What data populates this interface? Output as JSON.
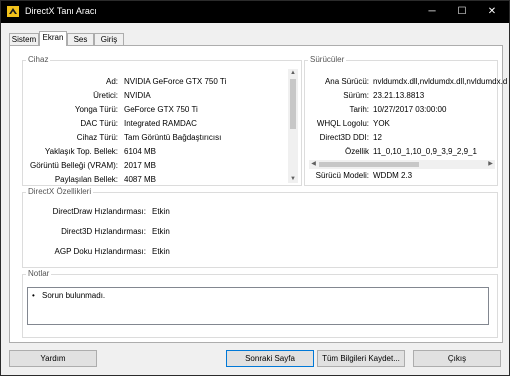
{
  "window": {
    "title": "DirectX Tanı Aracı",
    "controls": {
      "minimize": "─",
      "maximize": "☐",
      "close": "✕"
    }
  },
  "tabs": [
    {
      "label": "Sistem",
      "active": false
    },
    {
      "label": "Ekran",
      "active": true
    },
    {
      "label": "Ses",
      "active": false
    },
    {
      "label": "Giriş",
      "active": false
    }
  ],
  "device": {
    "title": "Cihaz",
    "rows": [
      {
        "label": "Ad:",
        "value": "NVIDIA GeForce GTX 750 Ti"
      },
      {
        "label": "Üretici:",
        "value": "NVIDIA"
      },
      {
        "label": "Yonga Türü:",
        "value": "GeForce GTX 750 Ti"
      },
      {
        "label": "DAC Türü:",
        "value": "Integrated RAMDAC"
      },
      {
        "label": "Cihaz Türü:",
        "value": "Tam Görüntü Bağdaştırıcısı"
      },
      {
        "label": "Yaklaşık Top. Bellek:",
        "value": "6104 MB"
      },
      {
        "label": "Görüntü Belleği (VRAM):",
        "value": "2017 MB"
      },
      {
        "label": "Paylaşılan Bellek:",
        "value": "4087 MB"
      }
    ]
  },
  "drivers": {
    "title": "Sürücüler",
    "rows": [
      {
        "label": "Ana Sürücü:",
        "value": "nvldumdx.dll,nvldumdx.dll,nvldumdx.d"
      },
      {
        "label": "Sürüm:",
        "value": "23.21.13.8813"
      },
      {
        "label": "Tarih:",
        "value": "10/27/2017 03:00:00"
      },
      {
        "label": "WHQL Logolu:",
        "value": "YOK"
      },
      {
        "label": "Direct3D DDI:",
        "value": "12"
      },
      {
        "label": "Özellik",
        "value": "11_0,10_1,10_0,9_3,9_2,9_1"
      },
      {
        "label": "Sürücü Modeli:",
        "value": "WDDM 2.3"
      }
    ]
  },
  "features": {
    "title": "DirectX Özellikleri",
    "rows": [
      {
        "label": "DirectDraw Hızlandırması:",
        "value": "Etkin"
      },
      {
        "label": "Direct3D Hızlandırması:",
        "value": "Etkin"
      },
      {
        "label": "AGP Doku Hızlandırması:",
        "value": "Etkin"
      }
    ]
  },
  "notes": {
    "title": "Notlar",
    "items": [
      "Sorun bulunmadı."
    ]
  },
  "buttons": {
    "help": "Yardım",
    "next_page": "Sonraki Sayfa",
    "save_all": "Tüm Bilgileri Kaydet...",
    "exit": "Çıkış"
  },
  "colors": {
    "titlebar": "#000000",
    "panel": "#ffffff",
    "window_bg": "#f0f0f0",
    "default_button_border": "#0078d7",
    "icon_yellow": "#f2c21b"
  }
}
